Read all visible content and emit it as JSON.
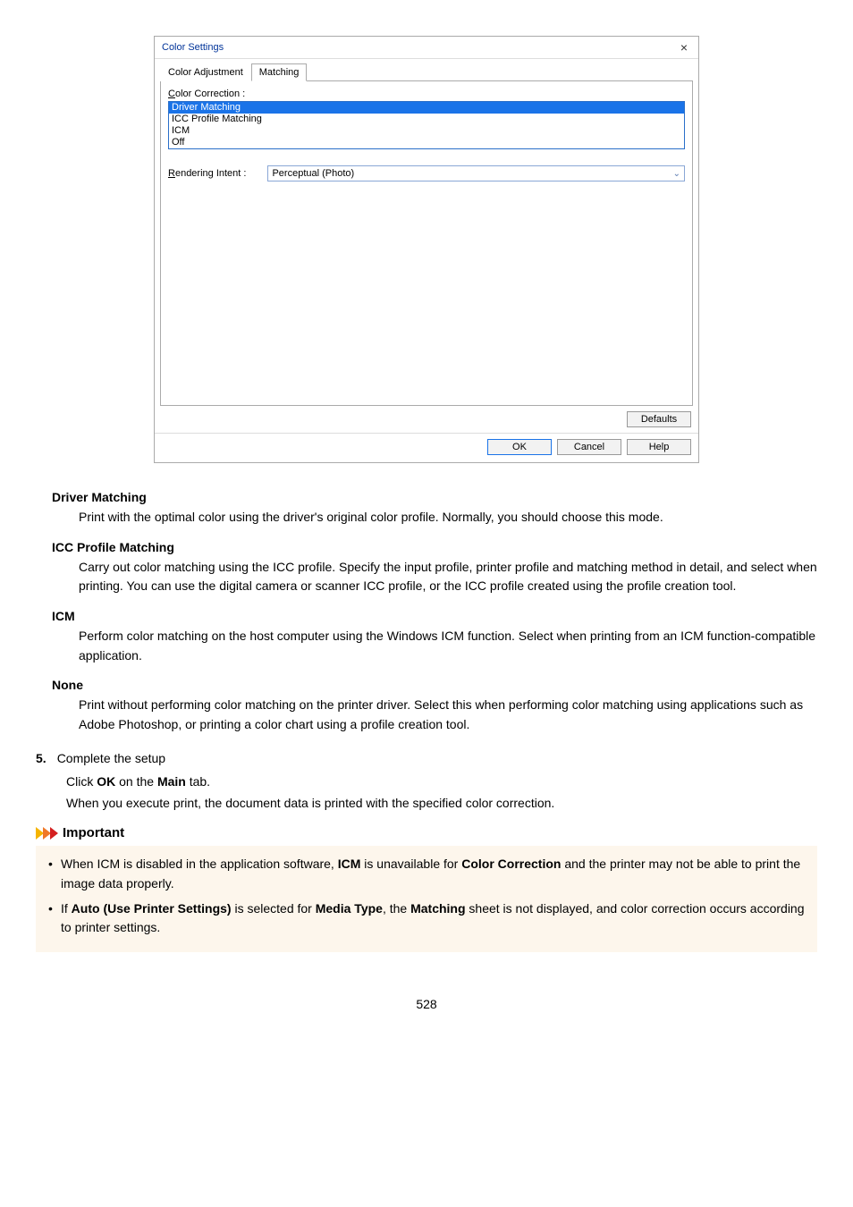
{
  "dialog": {
    "title": "Color Settings",
    "close": "×",
    "tabs": {
      "adjustment": "Color Adjustment",
      "matching": "Matching"
    },
    "cc_label_pre": "C",
    "cc_label_post": "olor Correction :",
    "cc_items": [
      "Driver Matching",
      "ICC Profile Matching",
      "ICM",
      "Off"
    ],
    "ri_label_pre": "R",
    "ri_label_post": "endering Intent :",
    "ri_value": "Perceptual (Photo)",
    "defaults": "Defaults",
    "ok": "OK",
    "cancel": "Cancel",
    "help": "Help"
  },
  "sections": {
    "s1_t": "Driver Matching",
    "s1_d": "Print with the optimal color using the driver's original color profile. Normally, you should choose this mode.",
    "s2_t": "ICC Profile Matching",
    "s2_d": "Carry out color matching using the ICC profile. Specify the input profile, printer profile and matching method in detail, and select when printing. You can use the digital camera or scanner ICC profile, or the ICC profile created using the profile creation tool.",
    "s3_t": "ICM",
    "s3_d": "Perform color matching on the host computer using the Windows ICM function. Select when printing from an ICM function-compatible application.",
    "s4_t": "None",
    "s4_d": "Print without performing color matching on the printer driver. Select this when performing color matching using applications such as Adobe Photoshop, or printing a color chart using a profile creation tool."
  },
  "step": {
    "num": "5.",
    "title": "Complete the setup",
    "p1a": "Click ",
    "p1b": "OK",
    "p1c": " on the ",
    "p1d": "Main",
    "p1e": " tab.",
    "p2": "When you execute print, the document data is printed with the specified color correction."
  },
  "important": {
    "title": "Important",
    "li1a": "When ICM is disabled in the application software, ",
    "li1b": "ICM",
    "li1c": " is unavailable for ",
    "li1d": "Color Correction",
    "li1e": " and the printer may not be able to print the image data properly.",
    "li2a": "If ",
    "li2b": "Auto (Use Printer Settings)",
    "li2c": " is selected for ",
    "li2d": "Media Type",
    "li2e": ", the ",
    "li2f": "Matching",
    "li2g": " sheet is not displayed, and color correction occurs according to printer settings."
  },
  "page": "528"
}
